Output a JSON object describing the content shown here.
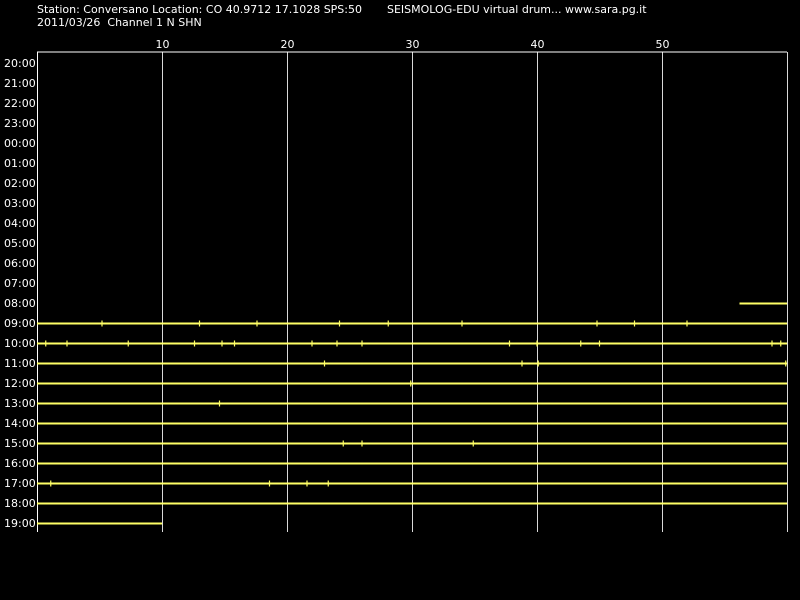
{
  "header": {
    "station_line": "Station: Conversano Location: CO 40.9712 17.1028 SPS:50",
    "brand_line": "SEISMOLOG-EDU virtual drum... www.sara.pg.it",
    "date_line": "2011/03/26  Channel 1 N SHN"
  },
  "colors": {
    "background": "#000000",
    "trace": "#ffff66",
    "grid": "#ffffff",
    "text": "#ffffff"
  },
  "chart_data": {
    "type": "line",
    "x_label": "",
    "y_label": "",
    "x_ticks": [
      "10",
      "20",
      "30",
      "40",
      "50"
    ],
    "x_range": [
      0,
      60
    ],
    "y_ticks": [
      "20:00",
      "21:00",
      "22:00",
      "23:00",
      "00:00",
      "01:00",
      "02:00",
      "03:00",
      "04:00",
      "05:00",
      "06:00",
      "07:00",
      "08:00",
      "09:00",
      "10:00",
      "11:00",
      "12:00",
      "13:00",
      "14:00",
      "15:00",
      "16:00",
      "17:00",
      "18:00",
      "19:00"
    ],
    "grid": "vertical",
    "series": [
      {
        "hour": "08:00",
        "start_min": 56.2,
        "end_min": 60
      },
      {
        "hour": "09:00",
        "start_min": 0,
        "end_min": 60,
        "blips": [
          5.2,
          13,
          17.6,
          24.2,
          28.1,
          34,
          44.8,
          47.8,
          52
        ]
      },
      {
        "hour": "10:00",
        "start_min": 0,
        "end_min": 60,
        "blips": [
          0.7,
          2.4,
          7.3,
          12.6,
          14.8,
          15.8,
          22,
          24,
          26,
          37.8,
          40,
          43.5,
          45,
          58.8,
          59.5
        ]
      },
      {
        "hour": "11:00",
        "start_min": 0,
        "end_min": 60,
        "blips": [
          23,
          38.8,
          40.1,
          59.9
        ]
      },
      {
        "hour": "12:00",
        "start_min": 0,
        "end_min": 60,
        "blips": [
          29.9
        ]
      },
      {
        "hour": "13:00",
        "start_min": 0,
        "end_min": 60,
        "blips": [
          14.6
        ]
      },
      {
        "hour": "14:00",
        "start_min": 0,
        "end_min": 60,
        "blips": []
      },
      {
        "hour": "15:00",
        "start_min": 0,
        "end_min": 60,
        "blips": [
          24.5,
          26,
          34.9
        ]
      },
      {
        "hour": "16:00",
        "start_min": 0,
        "end_min": 60,
        "blips": []
      },
      {
        "hour": "17:00",
        "start_min": 0,
        "end_min": 60,
        "blips": [
          1.1,
          18.6,
          21.6,
          23.3
        ]
      },
      {
        "hour": "18:00",
        "start_min": 0,
        "end_min": 60,
        "blips": []
      },
      {
        "hour": "19:00",
        "start_min": 0,
        "end_min": 10,
        "blips": []
      }
    ]
  }
}
